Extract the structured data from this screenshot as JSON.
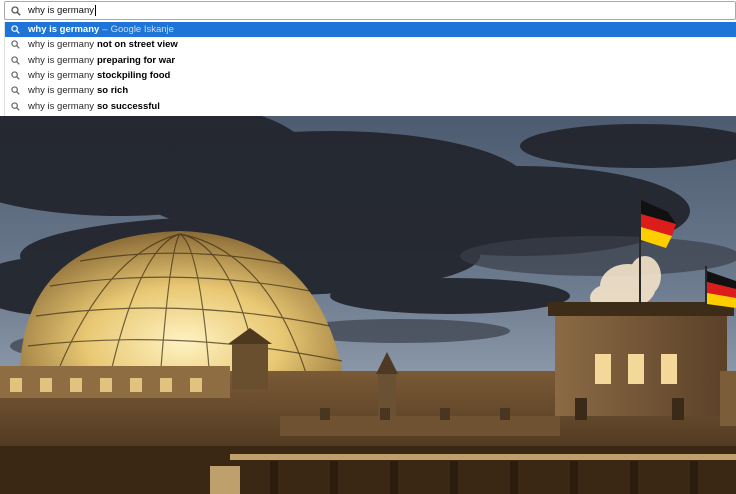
{
  "omnibox": {
    "value": "why is germany",
    "icon": "search-icon"
  },
  "suggestions": [
    {
      "typed": "why is germany",
      "sep": "–",
      "provider": "Google Iskanje",
      "completion": "",
      "selected": true
    },
    {
      "typed": "why is germany",
      "completion": "not on street view",
      "selected": false
    },
    {
      "typed": "why is germany",
      "completion": "preparing for war",
      "selected": false
    },
    {
      "typed": "why is germany",
      "completion": "stockpiling food",
      "selected": false
    },
    {
      "typed": "why is germany",
      "completion": "so rich",
      "selected": false
    },
    {
      "typed": "why is germany",
      "completion": "so successful",
      "selected": false
    }
  ],
  "colors": {
    "selection": "#1f74d8",
    "sky_top": "#5a6a82",
    "cloud": "#2a2d36",
    "dome_glow": "#f2d98a",
    "building": "#5c4428",
    "flag_black": "#111111",
    "flag_red": "#dd1c1c",
    "flag_gold": "#ffce00"
  },
  "photo": {
    "subject": "reichstag-dome-at-dusk-image"
  }
}
